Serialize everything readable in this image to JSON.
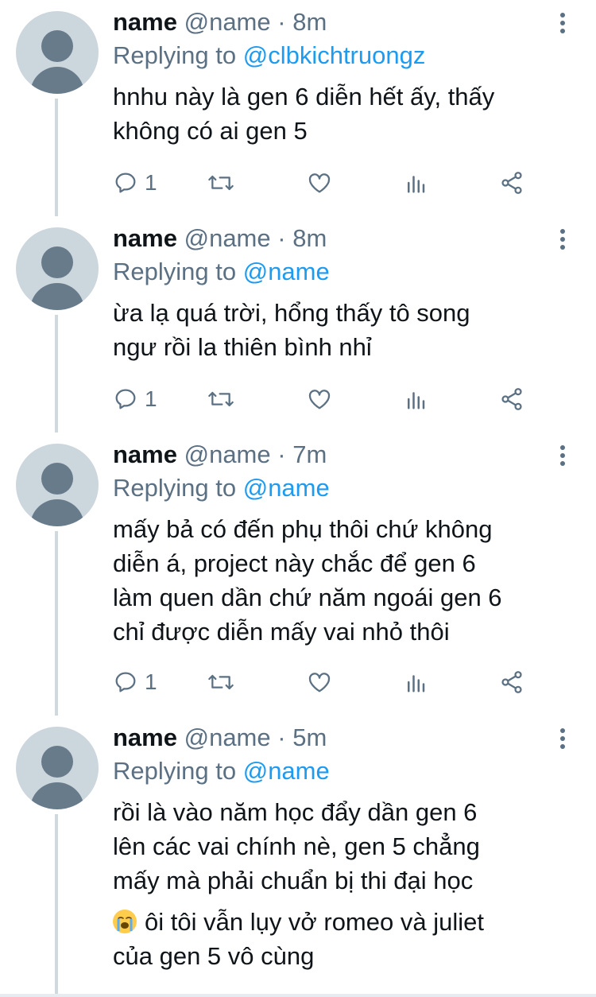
{
  "tweets": [
    {
      "name": "name",
      "handle": "@name",
      "separator": "·",
      "time": "8m",
      "replying_prefix": "Replying to",
      "replying_to": "@clbkichtruongz",
      "text_lines": [
        "hnhu này là gen 6 diễn hết ấy, thấy",
        "không có ai gen 5"
      ],
      "reply_count": "1"
    },
    {
      "name": "name",
      "handle": "@name",
      "separator": "·",
      "time": "8m",
      "replying_prefix": "Replying to",
      "replying_to": "@name",
      "text_lines": [
        "ừa lạ quá trời, hổng thấy tô song",
        "ngư rồi la thiên bình nhỉ"
      ],
      "reply_count": "1"
    },
    {
      "name": "name",
      "handle": "@name",
      "separator": "·",
      "time": "7m",
      "replying_prefix": "Replying to",
      "replying_to": "@name",
      "text_lines": [
        "mấy bả có đến phụ thôi chứ không",
        "diễn á, project này chắc để gen 6",
        "làm quen dần chứ năm ngoái gen 6",
        "chỉ được diễn mấy vai nhỏ thôi"
      ],
      "reply_count": "1"
    },
    {
      "name": "name",
      "handle": "@name",
      "separator": "·",
      "time": "5m",
      "replying_prefix": "Replying to",
      "replying_to": "@name",
      "text_lines": [
        "rồi là vào năm học đẩy dần gen 6",
        "lên các vai chính nè, gen 5 chẳng",
        "mấy mà phải chuẩn bị thi đại học"
      ],
      "emoji_line": "ôi tôi vẫn lụy vở romeo và juliet",
      "final_line": "của gen 5 vô cùng"
    }
  ],
  "icons": {
    "reply": "reply-icon",
    "retweet": "retweet-icon",
    "like": "heart-icon",
    "analytics": "analytics-icon",
    "share": "share-icon",
    "more": "more-options-icon",
    "emoji": "loudly-crying-face-emoji"
  },
  "colors": {
    "mention": "#1d9bf0",
    "secondary_text": "#5b7083",
    "primary_text": "#0f1419",
    "thread_line": "#cfd9de"
  }
}
